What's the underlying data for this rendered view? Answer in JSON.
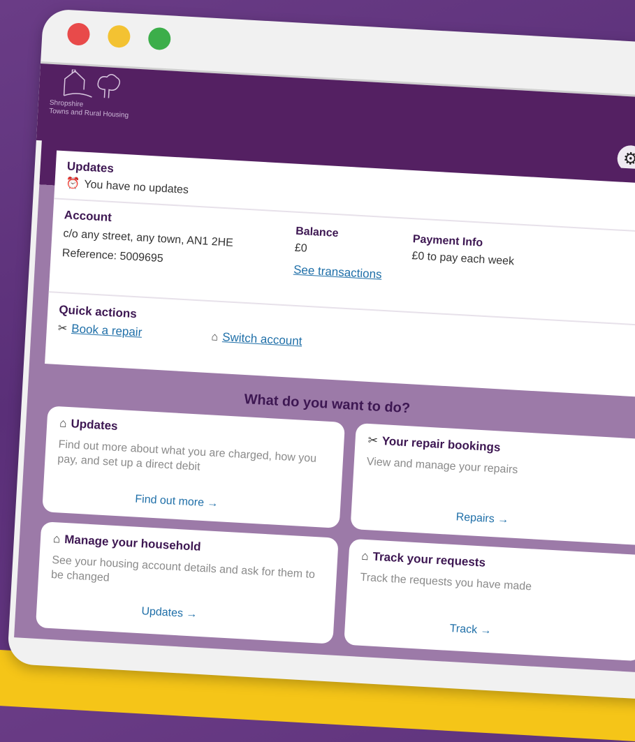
{
  "brand": {
    "logo_line1": "Shropshire",
    "logo_line2": "Towns and Rural Housing",
    "colors": {
      "primary": "#542062",
      "accent_yellow": "#f5c518",
      "link": "#1f6fa8"
    }
  },
  "window": {
    "controls": [
      "close",
      "minimize",
      "maximize"
    ]
  },
  "header": {
    "settings_icon": "gear-icon"
  },
  "updates": {
    "title": "Updates",
    "message": "You have no updates",
    "icon": "alarm-clock-icon"
  },
  "account": {
    "title": "Account",
    "address": "c/o any street, any town, AN1 2HE",
    "reference": "Reference: 5009695"
  },
  "balance": {
    "title": "Balance",
    "value": "£0",
    "link": "See transactions"
  },
  "payment": {
    "title": "Payment Info",
    "value": "£0 to pay each week"
  },
  "quick_actions": {
    "title": "Quick actions",
    "items": [
      {
        "label": "Book a repair",
        "icon": "tools-icon"
      },
      {
        "label": "Switch account",
        "icon": "home-icon"
      }
    ]
  },
  "main": {
    "heading": "What do you want to do?",
    "cards": [
      {
        "title": "Updates",
        "icon": "home-icon",
        "description": "Find out more about what you are charged, how you pay, and set up a direct debit",
        "link": "Find out more"
      },
      {
        "title": "Your repair bookings",
        "icon": "tools-icon",
        "description": "View and manage your repairs",
        "link": "Repairs"
      },
      {
        "title": "Manage your household",
        "icon": "home-icon",
        "description": "See your housing account details and ask  for them to be changed",
        "link": "Updates"
      },
      {
        "title": "Track your requests",
        "icon": "home-icon",
        "description": "Track the requests you have made",
        "link": "Track"
      }
    ]
  }
}
